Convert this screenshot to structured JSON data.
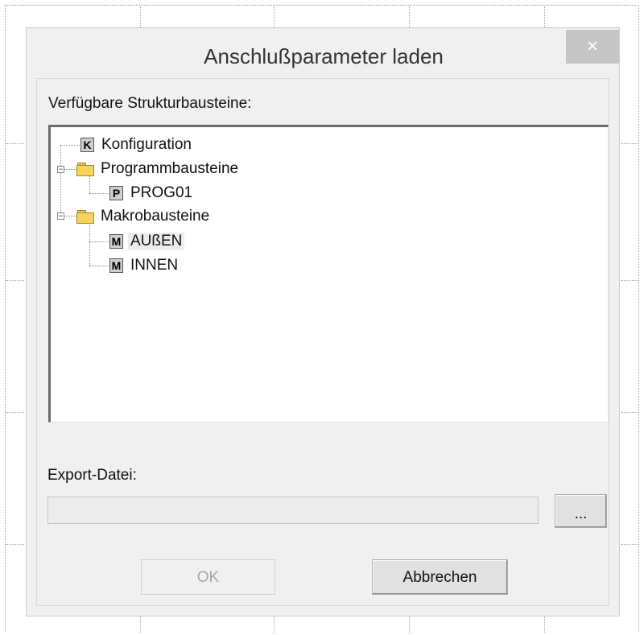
{
  "dialog": {
    "title": "Anschlußparameter laden",
    "close_label": "×"
  },
  "structure_label": "Verfügbare Strukturbausteine:",
  "tree": {
    "nodes": [
      {
        "label": "Konfiguration",
        "icon": "K"
      },
      {
        "label": "Programmbausteine",
        "icon": "folder",
        "expanded": true
      },
      {
        "label": "PROG01",
        "icon": "P"
      },
      {
        "label": "Makrobausteine",
        "icon": "folder",
        "expanded": true
      },
      {
        "label": "AUßEN",
        "icon": "M",
        "selected": true
      },
      {
        "label": "INNEN",
        "icon": "M"
      }
    ],
    "expanded_symbol": "−"
  },
  "export": {
    "label": "Export-Datei:",
    "value": "",
    "browse_label": "..."
  },
  "buttons": {
    "ok": "OK",
    "cancel": "Abbrechen"
  }
}
